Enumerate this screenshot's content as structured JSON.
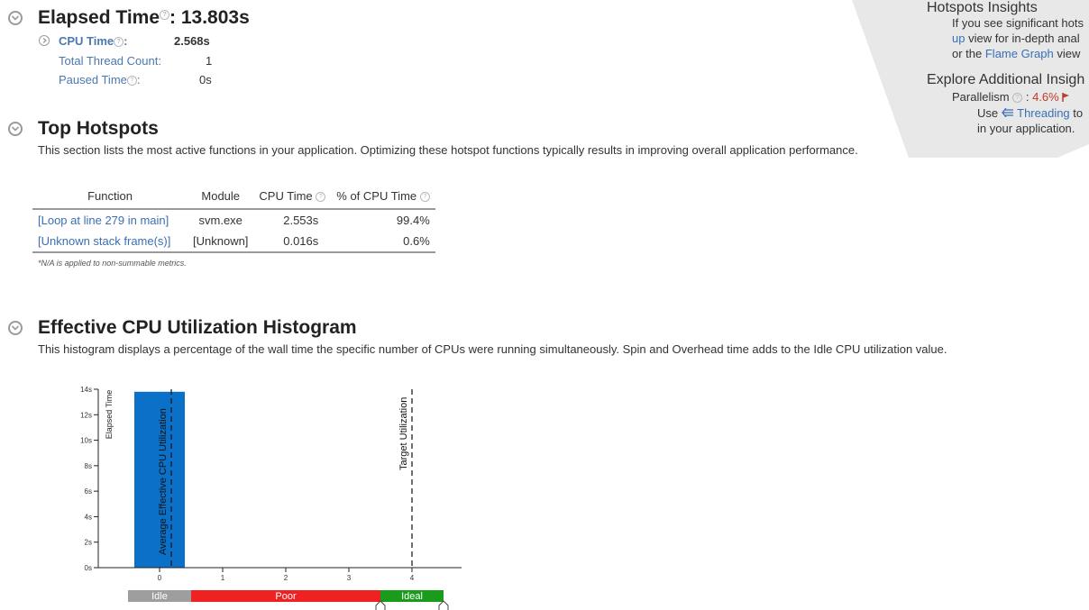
{
  "summary": {
    "elapsed_label": "Elapsed Time",
    "elapsed_value": ": 13.803s",
    "cpu_time_label": "CPU Time",
    "cpu_time_colon": ":",
    "cpu_time_value": "2.568s",
    "thread_count_label": "Total Thread Count:",
    "thread_count_value": "1",
    "paused_label": "Paused Time",
    "paused_colon": ":",
    "paused_value": "0s"
  },
  "hotspots": {
    "title": "Top Hotspots",
    "description": "This section lists the most active functions in your application. Optimizing these hotspot functions typically results in improving overall application performance.",
    "columns": [
      "Function",
      "Module",
      "CPU Time",
      "% of CPU Time"
    ],
    "rows": [
      {
        "function": "[Loop at line 279 in main]",
        "module": "svm.exe",
        "cpu_time": "2.553s",
        "percent": "99.4%"
      },
      {
        "function": "[Unknown stack frame(s)]",
        "module": "[Unknown]",
        "cpu_time": "0.016s",
        "percent": "0.6%"
      }
    ],
    "footnote": "*N/A is applied to non-summable metrics."
  },
  "histogram": {
    "title": "Effective CPU Utilization Histogram",
    "description": "This histogram displays a percentage of the wall time the specific number of CPUs were running simultaneously. Spin and Overhead time adds to the Idle CPU utilization value.",
    "avg_label": "Average Effective CPU Utilization",
    "target_label": "Target Utilization",
    "bands": {
      "idle": "Idle",
      "poor": "Poor",
      "ideal": "Ideal"
    },
    "colors": {
      "bar": "#0a70c8",
      "idle": "#9e9e9e",
      "poor": "#ee2222",
      "ideal": "#1a9b1a"
    }
  },
  "chart_data": {
    "type": "bar",
    "x": [
      0,
      1,
      2,
      3,
      4
    ],
    "values": [
      13.803,
      0,
      0,
      0,
      0
    ],
    "xlabel": "",
    "ylabel": "Elapsed Time",
    "ylim": [
      0,
      14
    ],
    "yticks": [
      "0s",
      "2s",
      "4s",
      "6s",
      "8s",
      "10s",
      "12s",
      "14s"
    ],
    "xticks": [
      "0",
      "1",
      "2",
      "3",
      "4"
    ],
    "avg_utilization": 0.186,
    "target_utilization": 4
  },
  "insights": {
    "title1": "Hotspots Insights",
    "line1": "If you see significant hots",
    "line2_link": "up",
    "line2_rest": " view for in-depth anal",
    "line3_pre": "or the ",
    "line3_link": "Flame Graph",
    "line3_post": " view",
    "title2": "Explore Additional Insigh",
    "parallelism_label": "Parallelism",
    "parallelism_sep": ":",
    "parallelism_value": "4.6%",
    "use_pre": "Use ",
    "use_link": "Threading",
    "use_post": " to",
    "last_line": "in your application."
  }
}
